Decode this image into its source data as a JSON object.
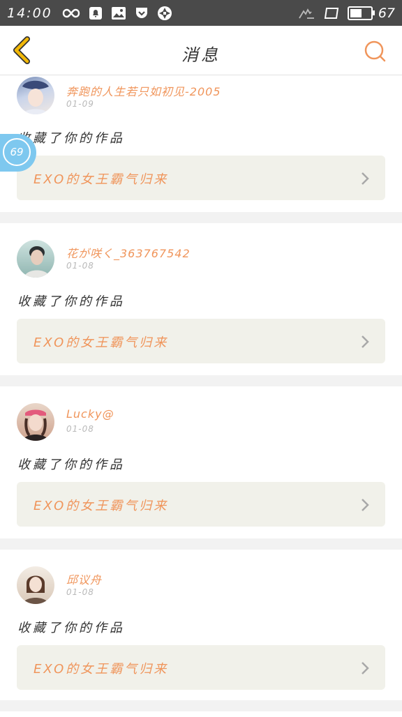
{
  "status_bar": {
    "time": "14:00",
    "battery_level": "67",
    "battery_fill": 0.67,
    "icons": [
      "infinity-icon",
      "notification-bell-icon",
      "image-icon",
      "pocket-icon",
      "aperture-icon",
      "hand-gesture-icon",
      "tablet-icon",
      "battery-icon"
    ]
  },
  "nav": {
    "title": "消息",
    "back_icon": "chevron-left-icon",
    "search_icon": "search-icon"
  },
  "badge": {
    "count": "69"
  },
  "messages": [
    {
      "username": "奔跑的人生若只如初见-2005",
      "date": "01-09",
      "action": "收藏了你的作品",
      "work_title": "EXO的女王霸气归来"
    },
    {
      "username": "花が咲く_363767542",
      "date": "01-08",
      "action": "收藏了你的作品",
      "work_title": "EXO的女王霸气归来"
    },
    {
      "username": "Lucky@",
      "date": "01-08",
      "action": "收藏了你的作品",
      "work_title": "EXO的女王霸气归来"
    },
    {
      "username": "邱议舟",
      "date": "01-08",
      "action": "收藏了你的作品",
      "work_title": "EXO的女王霸气归来"
    }
  ],
  "colors": {
    "accent": "#f0955b",
    "back_icon": "#f2b807",
    "status_bar": "#4a4a4a",
    "badge": "#7ec8ef",
    "work_bg": "#f1f1ea"
  }
}
